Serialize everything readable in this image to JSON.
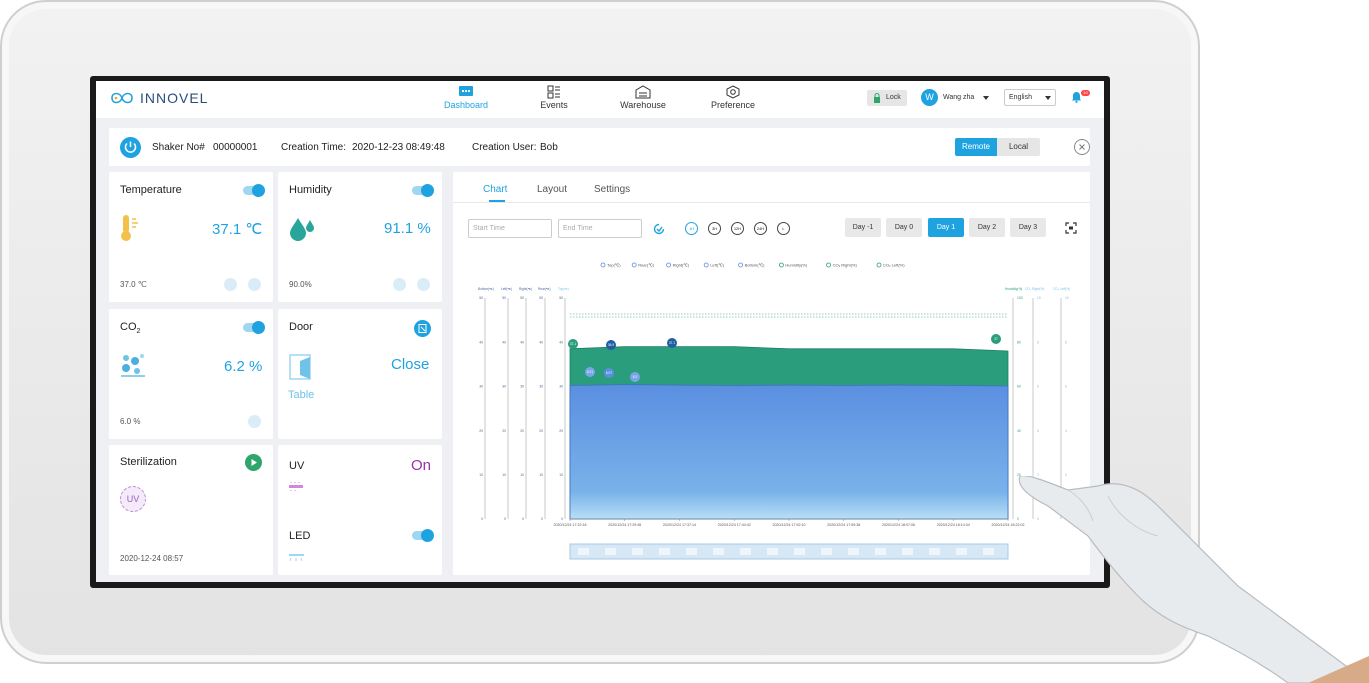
{
  "brand": {
    "name": "INNOVEL"
  },
  "nav": [
    {
      "label": "Dashboard",
      "active": true,
      "icon": "dashboard-icon"
    },
    {
      "label": "Events",
      "active": false,
      "icon": "events-icon"
    },
    {
      "label": "Warehouse",
      "active": false,
      "icon": "warehouse-icon"
    },
    {
      "label": "Preference",
      "active": false,
      "icon": "preference-icon"
    }
  ],
  "header": {
    "lock_label": "Lock",
    "user_initial": "W",
    "user_name": "Wang zha",
    "language": "English",
    "notifications": "10"
  },
  "info": {
    "shaker_label": "Shaker No#",
    "shaker_no": "00000001",
    "creation_time_label": "Creation Time:",
    "creation_time": "2020-12-23 08:49:48",
    "creation_user_label": "Creation User:",
    "creation_user": "Bob",
    "remote_label": "Remote",
    "local_label": "Local",
    "mode": "Remote"
  },
  "cards": {
    "temperature": {
      "title": "Temperature",
      "value": "37.1 ℃",
      "setpoint": "37.0 ℃",
      "enabled": true
    },
    "humidity": {
      "title": "Humidity",
      "value": "91.1 %",
      "setpoint": "90.0%",
      "enabled": true
    },
    "co2": {
      "title": "CO",
      "title_sub": "2",
      "value": "6.2 %",
      "setpoint": "6.0 %",
      "enabled": true
    },
    "door": {
      "title": "Door",
      "state": "Close",
      "item": "Table"
    },
    "sterilization": {
      "title": "Sterilization",
      "uv_badge": "UV",
      "time": "2020-12-24  08:57"
    },
    "uv": {
      "title": "UV",
      "state": "On"
    },
    "led": {
      "title": "LED",
      "enabled": true
    }
  },
  "chart_tabs": [
    "Chart",
    "Layout",
    "Settings"
  ],
  "active_tab": "Chart",
  "filters": {
    "start_placeholder": "Start Time",
    "end_placeholder": "End Time"
  },
  "ranges": [
    "1H",
    "3H",
    "12H",
    "24H",
    "L"
  ],
  "days": [
    "Day -1",
    "Day 0",
    "Day 1",
    "Day 2",
    "Day 3"
  ],
  "active_day": "Day 1",
  "colors": {
    "accent": "#1fa3e0",
    "humidity_area": "#2a9d7c",
    "temperature_area": "#5a8fe0",
    "uv_on": "#9b2fae"
  },
  "chart_data": {
    "type": "area",
    "legend": [
      "Top(℃)",
      "Rear(℃)",
      "Right(℃)",
      "Left(℃)",
      "Bottom(℃)",
      "Humidity(%)",
      "CO₂ Right(%)",
      "CO₂ Left(%)"
    ],
    "legend_position": "top",
    "left_axis_labels": [
      "Bottom(℃)",
      "Left(℃)",
      "Right(℃)",
      "Rear(℃)",
      "Top(℃)"
    ],
    "right_axis_labels": [
      "Humidity(%)",
      "CO₂ Right(%)",
      "CO₂ Left(%)"
    ],
    "y_left_ticks": [
      0,
      10,
      20,
      30,
      40,
      50
    ],
    "y_humidity_ticks": [
      0,
      20,
      40,
      60,
      80,
      100
    ],
    "y_co2_ticks": [
      0,
      2,
      4,
      6,
      8,
      10
    ],
    "x": [
      "2020/12/24 17:22:18",
      "2020/12/24 17:29:46",
      "2020/12/24 17:37:14",
      "2020/12/24 17:44:42",
      "2020/12/24 17:52:10",
      "2020/12/24 17:59:38",
      "2020/12/24 18:07:06",
      "2020/12/24 18:14:34",
      "2020/12/24 18:22:02"
    ],
    "series": [
      {
        "name": "Humidity(%)",
        "values": [
          77,
          78,
          78,
          78,
          77,
          77,
          77,
          77,
          76
        ]
      },
      {
        "name": "Top(℃)",
        "values": [
          30.2,
          30.4,
          30.3,
          30.2,
          30.3,
          30.2,
          30.3,
          30.2,
          30.1
        ]
      }
    ],
    "markers": [
      "37.1",
      "36.9",
      "37.1",
      "37",
      "6.21",
      "6.07",
      "6.2"
    ],
    "grid": false
  }
}
